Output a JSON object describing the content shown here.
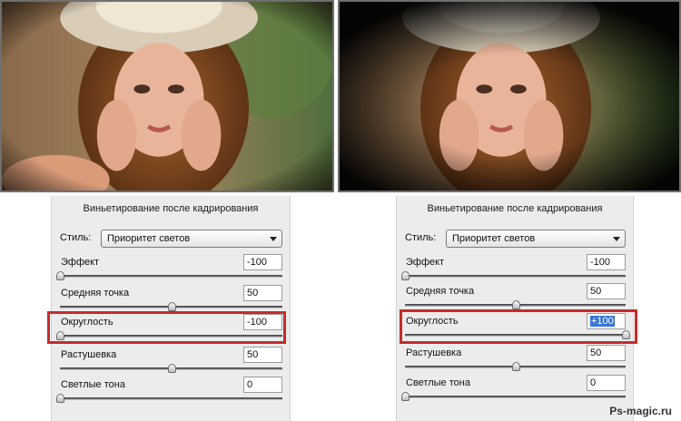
{
  "panels": {
    "left": {
      "title": "Виньетирование после кадрирования",
      "style_label": "Стиль:",
      "style_value": "Приоритет светов",
      "params": [
        {
          "label": "Эффект",
          "value": "-100",
          "level": 0.0
        },
        {
          "label": "Средняя точка",
          "value": "50",
          "level": 0.5
        },
        {
          "label": "Округлость",
          "value": "-100",
          "level": 0.0
        },
        {
          "label": "Растушевка",
          "value": "50",
          "level": 0.5
        },
        {
          "label": "Светлые тона",
          "value": "0",
          "level": 0.0
        }
      ]
    },
    "right": {
      "title": "Виньетирование после кадрирования",
      "style_label": "Стиль:",
      "style_value": "Приоритет светов",
      "params": [
        {
          "label": "Эффект",
          "value": "-100",
          "level": 0.0
        },
        {
          "label": "Средняя точка",
          "value": "50",
          "level": 0.5
        },
        {
          "label": "Округлость",
          "value": "+100",
          "level": 1.0
        },
        {
          "label": "Растушевка",
          "value": "50",
          "level": 0.5
        },
        {
          "label": "Светлые тона",
          "value": "0",
          "level": 0.0
        }
      ]
    }
  },
  "colors": {
    "highlight": "#c62b2b",
    "selection": "#3875d7"
  },
  "watermark": "Ps-magic.ru"
}
